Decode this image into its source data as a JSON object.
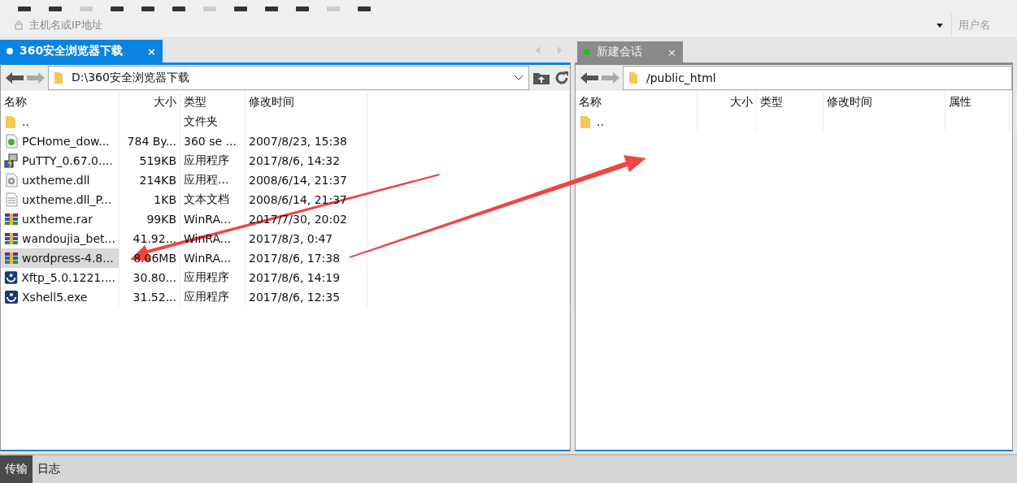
{
  "address_bar": {
    "host_placeholder": "主机名或IP地址",
    "user_placeholder": "用户名"
  },
  "panes": [
    {
      "tab": {
        "label": "360安全浏览器下载",
        "selected": true,
        "color": "#ffffff",
        "close": "×"
      },
      "path": "D:\\360安全浏览器下载",
      "columns": [
        "名称",
        "大小",
        "类型",
        "修改时间"
      ],
      "rows": [
        {
          "kind": "folder",
          "name": "..",
          "size": "",
          "type": "文件夹",
          "modified": "",
          "selected": false
        },
        {
          "kind": "web",
          "name": "PCHome_dow...",
          "size": "784 By...",
          "type": "360 se ...",
          "modified": "2007/8/23, 15:38",
          "selected": false
        },
        {
          "kind": "putty",
          "name": "PuTTY_0.67.0....",
          "size": "519KB",
          "type": "应用程序",
          "modified": "2017/8/6, 14:32",
          "selected": false
        },
        {
          "kind": "dll",
          "name": "uxtheme.dll",
          "size": "214KB",
          "type": "应用程...",
          "modified": "2008/6/14, 21:37",
          "selected": false
        },
        {
          "kind": "text",
          "name": "uxtheme.dll_P...",
          "size": "1KB",
          "type": "文本文档",
          "modified": "2008/6/14, 21:37",
          "selected": false
        },
        {
          "kind": "rar",
          "name": "uxtheme.rar",
          "size": "99KB",
          "type": "WinRA...",
          "modified": "2017/7/30, 20:02",
          "selected": false
        },
        {
          "kind": "rar",
          "name": "wandoujia_bet...",
          "size": "41.92...",
          "type": "WinRA...",
          "modified": "2017/8/3, 0:47",
          "selected": false
        },
        {
          "kind": "rar",
          "name": "wordpress-4.8...",
          "size": "8.06MB",
          "type": "WinRA...",
          "modified": "2017/8/6, 17:38",
          "selected": true
        },
        {
          "kind": "app",
          "name": "Xftp_5.0.1221....",
          "size": "30.80...",
          "type": "应用程序",
          "modified": "2017/8/6, 14:19",
          "selected": false
        },
        {
          "kind": "app",
          "name": "Xshell5.exe",
          "size": "31.52...",
          "type": "应用程序",
          "modified": "2017/8/6, 12:35",
          "selected": false
        }
      ]
    },
    {
      "tab": {
        "label": "新建会话",
        "selected": false,
        "color": "#22c022",
        "close": "×"
      },
      "path": "/public_html",
      "columns": [
        "名称",
        "大小",
        "类型",
        "修改时间",
        "属性"
      ],
      "rows": [
        {
          "kind": "folder",
          "name": "..",
          "size": "",
          "type": "",
          "modified": "",
          "selected": false
        }
      ]
    }
  ],
  "bottom_tabs": [
    {
      "label": "传输",
      "selected": true
    },
    {
      "label": "日志",
      "selected": false
    }
  ]
}
